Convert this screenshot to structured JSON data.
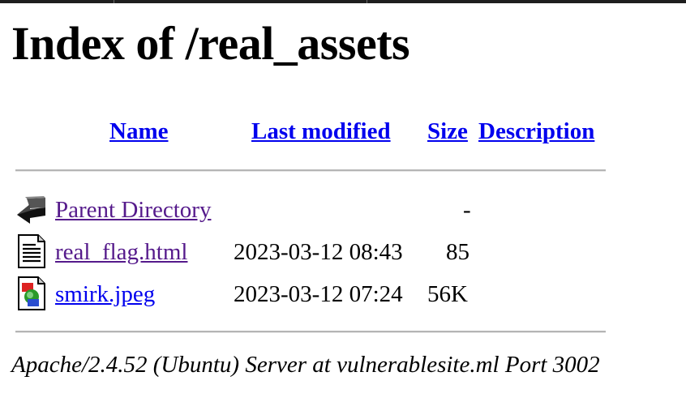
{
  "page": {
    "title": "Index of /real_assets"
  },
  "table": {
    "headers": {
      "name": "Name",
      "last_modified": "Last modified",
      "size": "Size",
      "description": "Description"
    },
    "rows": [
      {
        "icon": "back-arrow-icon",
        "name": "Parent Directory",
        "last_modified": "",
        "size": "-",
        "description": ""
      },
      {
        "icon": "text-file-icon",
        "name": "real_flag.html",
        "last_modified": "2023-03-12 08:43",
        "size": "85",
        "description": ""
      },
      {
        "icon": "image-file-icon",
        "name": "smirk.jpeg",
        "last_modified": "2023-03-12 07:24",
        "size": "56K",
        "description": ""
      }
    ]
  },
  "footer": {
    "address": "Apache/2.4.52 (Ubuntu) Server at vulnerablesite.ml Port 3002"
  }
}
